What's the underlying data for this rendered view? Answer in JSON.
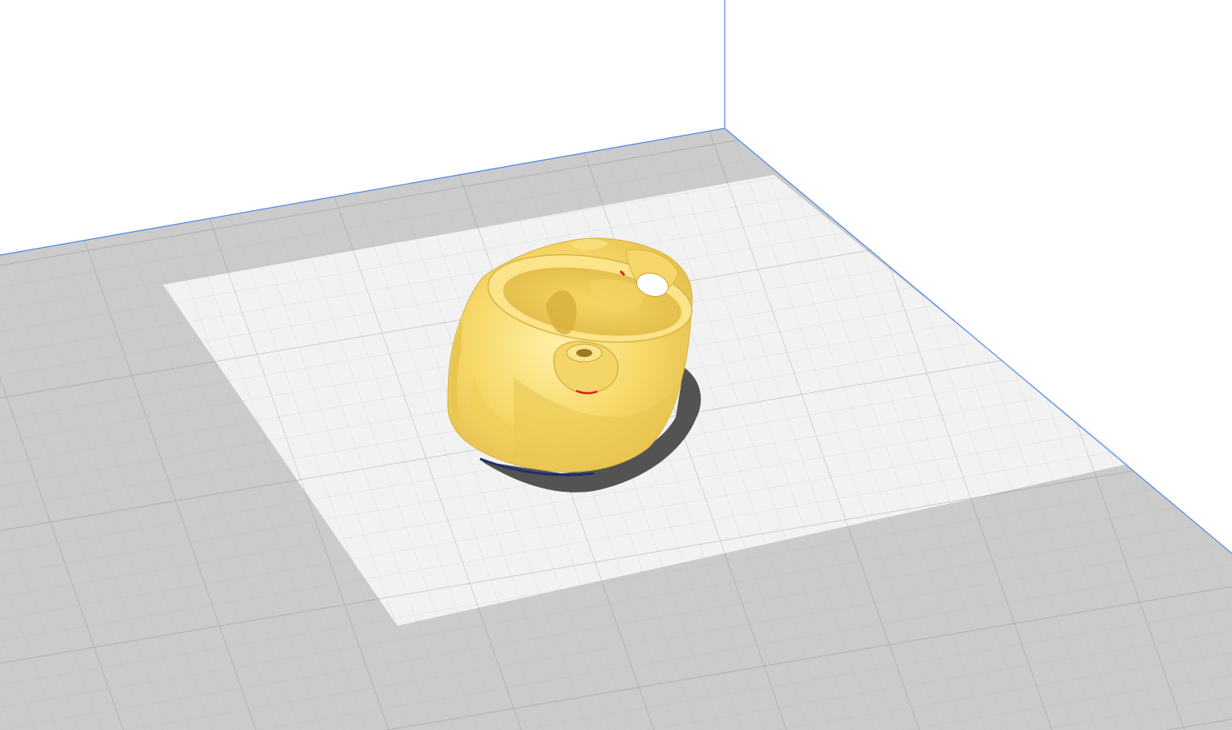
{
  "viewport": {
    "background_color": "#ffffff",
    "build_plate_color": "#c9c9c9",
    "build_plate_inner_color": "#f1f1f1",
    "grid_line_color": "#b7b7b7",
    "volume_edge_color": "#4a86e8"
  },
  "model": {
    "color": "#f7d96a",
    "shade_color": "#e7c24c",
    "highlight_color": "#fff0a6",
    "overhang_color": "#d81b1b",
    "shadow_color": "#4a4a4a"
  }
}
